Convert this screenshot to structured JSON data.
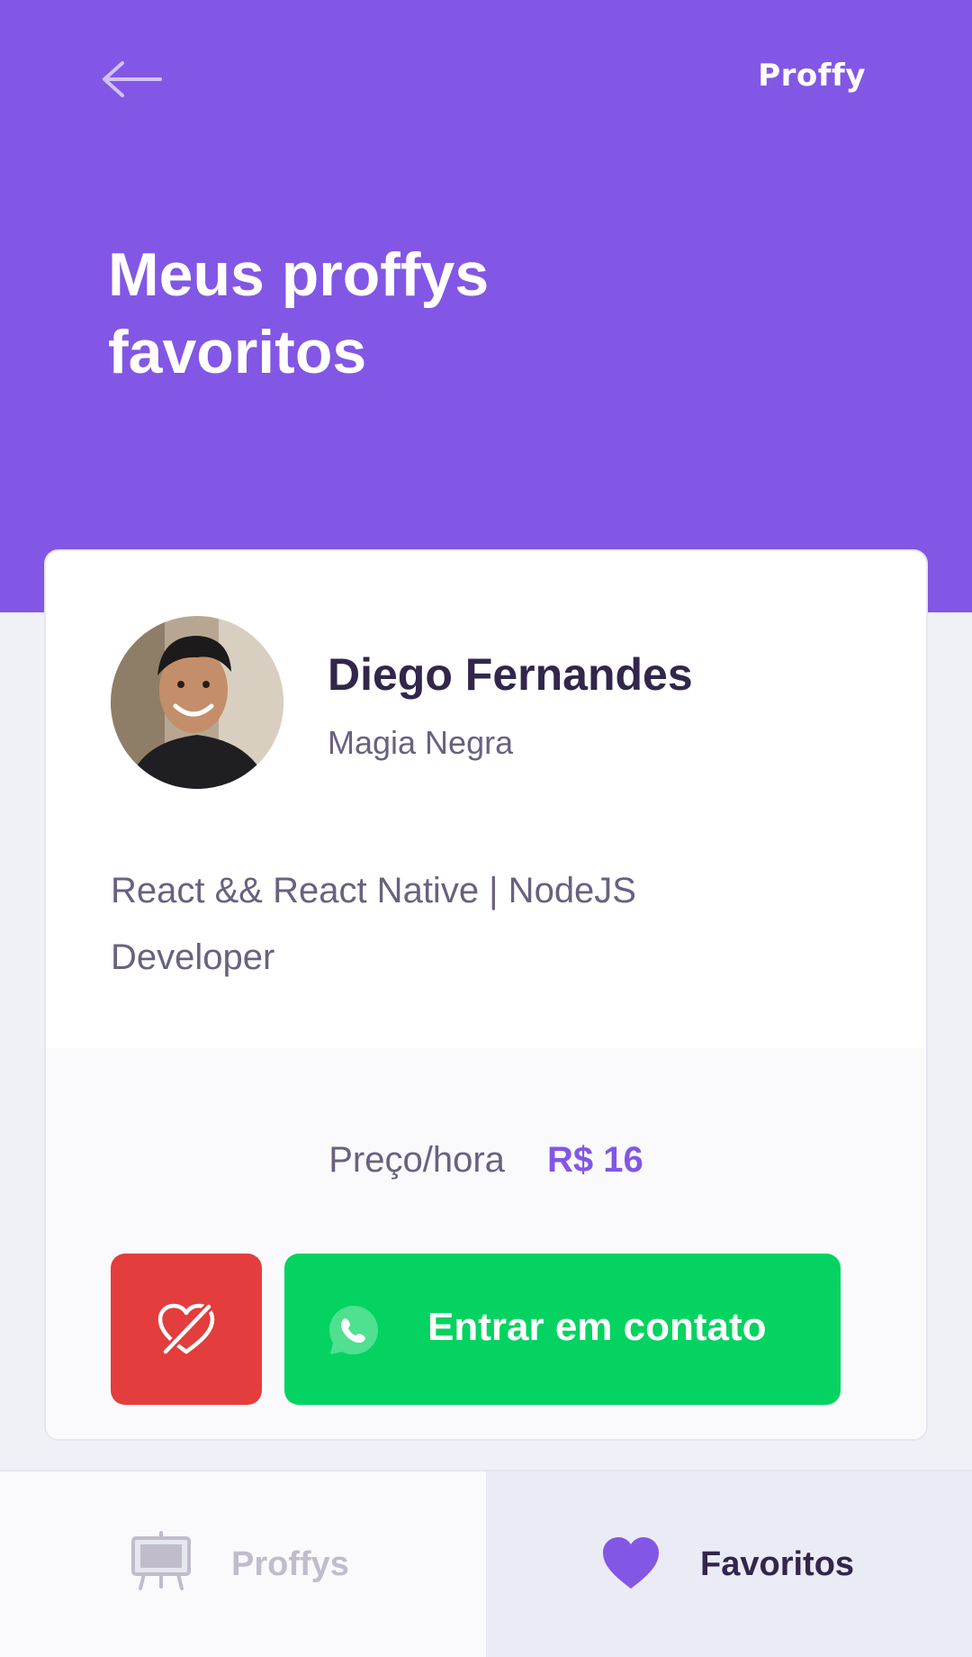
{
  "header": {
    "app_logo": "Proffy",
    "title": "Meus proffys favoritos",
    "back_icon": "arrow-left-icon",
    "background": "#8257E5"
  },
  "teacher_card": {
    "name": "Diego Fernandes",
    "subject": "Magia Negra",
    "bio": "React && React Native | NodeJS Developer",
    "price_label": "Preço/hora",
    "price_value": "R$ 16",
    "unfavorite_icon": "unfavorite-heart-icon",
    "contact_icon": "whatsapp-icon",
    "contact_label": "Entrar em contato"
  },
  "tabs": [
    {
      "label": "Proffys",
      "icon": "easel-icon",
      "active": false
    },
    {
      "label": "Favoritos",
      "icon": "heart-icon",
      "active": true
    }
  ],
  "colors": {
    "primary": "#8257E5",
    "danger": "#E33D3D",
    "success": "#04D361",
    "title_text": "#32264D",
    "body_text": "#6A6180"
  }
}
